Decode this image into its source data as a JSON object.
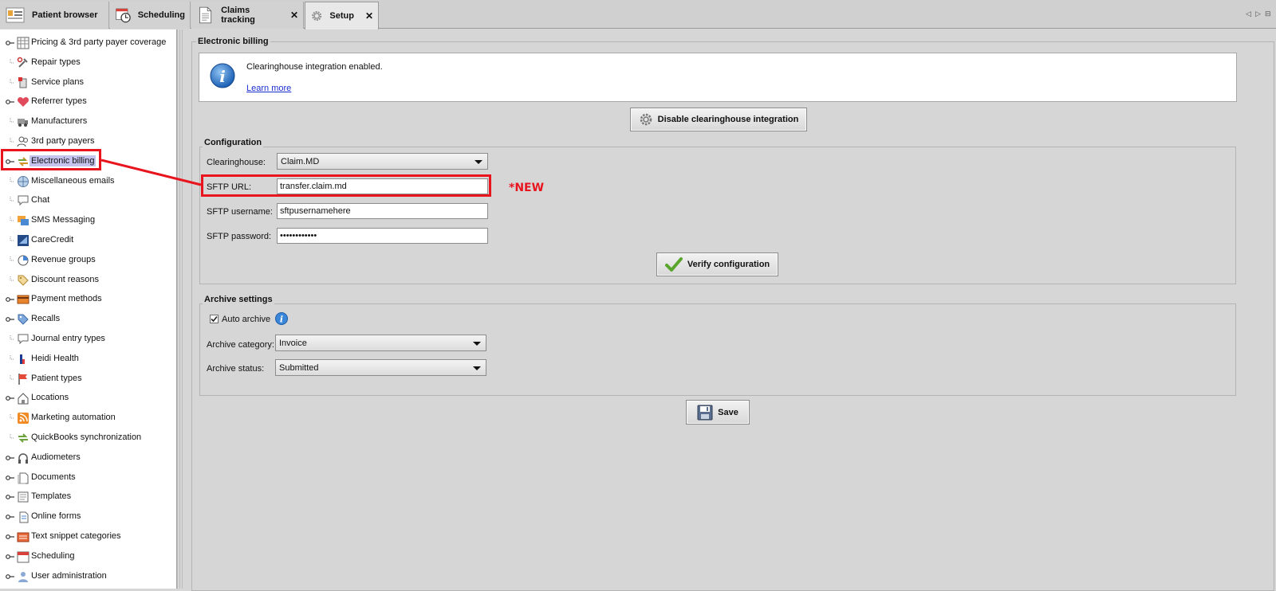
{
  "tabs": [
    {
      "label": "Patient browser",
      "icon": "patient-browser-icon",
      "active": false,
      "closable": false
    },
    {
      "label": "Scheduling",
      "icon": "calendar-clock-icon",
      "active": false,
      "closable": false
    },
    {
      "label": "Claims tracking",
      "icon": "document-icon",
      "active": false,
      "closable": true
    },
    {
      "label": "Setup",
      "icon": "gear-icon",
      "active": true,
      "closable": true
    }
  ],
  "tab_close_glyph": "✕",
  "tab_nav": {
    "left": "◁",
    "right": "▷",
    "menu": "⊟"
  },
  "tree": {
    "items": [
      {
        "label": "Pricing & 3rd party payer coverage",
        "icon": "pricing-table-icon",
        "expandable": true
      },
      {
        "label": "Repair types",
        "icon": "tools-icon",
        "expandable": false
      },
      {
        "label": "Service plans",
        "icon": "service-plan-icon",
        "expandable": false
      },
      {
        "label": "Referrer types",
        "icon": "heart-icon",
        "expandable": true
      },
      {
        "label": "Manufacturers",
        "icon": "truck-icon",
        "expandable": false
      },
      {
        "label": "3rd party payers",
        "icon": "people-icon",
        "expandable": false
      },
      {
        "label": "Electronic billing",
        "icon": "exchange-arrows-icon",
        "expandable": true,
        "selected": true
      },
      {
        "label": "Miscellaneous emails",
        "icon": "globe-icon",
        "expandable": false
      },
      {
        "label": "Chat",
        "icon": "chat-bubble-icon",
        "expandable": false
      },
      {
        "label": "SMS Messaging",
        "icon": "sms-icon",
        "expandable": false
      },
      {
        "label": "CareCredit",
        "icon": "carecredit-icon",
        "expandable": false
      },
      {
        "label": "Revenue groups",
        "icon": "pie-chart-icon",
        "expandable": false
      },
      {
        "label": "Discount reasons",
        "icon": "tag-icon",
        "expandable": false
      },
      {
        "label": "Payment methods",
        "icon": "payment-icon",
        "expandable": true
      },
      {
        "label": "Recalls",
        "icon": "recall-tag-icon",
        "expandable": true
      },
      {
        "label": "Journal entry types",
        "icon": "journal-bubble-icon",
        "expandable": false
      },
      {
        "label": "Heidi Health",
        "icon": "heidi-health-icon",
        "expandable": false
      },
      {
        "label": "Patient types",
        "icon": "flag-icon",
        "expandable": false
      },
      {
        "label": "Locations",
        "icon": "house-icon",
        "expandable": true
      },
      {
        "label": "Marketing automation",
        "icon": "rss-icon",
        "expandable": false
      },
      {
        "label": "QuickBooks synchronization",
        "icon": "sync-arrows-icon",
        "expandable": false
      },
      {
        "label": "Audiometers",
        "icon": "headphones-icon",
        "expandable": true
      },
      {
        "label": "Documents",
        "icon": "documents-icon",
        "expandable": true
      },
      {
        "label": "Templates",
        "icon": "template-icon",
        "expandable": true
      },
      {
        "label": "Online forms",
        "icon": "online-form-icon",
        "expandable": true
      },
      {
        "label": "Text snippet categories",
        "icon": "snippet-icon",
        "expandable": true
      },
      {
        "label": "Scheduling",
        "icon": "calendar-icon",
        "expandable": true
      },
      {
        "label": "User administration",
        "icon": "user-admin-icon",
        "expandable": true
      }
    ]
  },
  "main": {
    "section_title": "Electronic billing",
    "info": {
      "message": "Clearinghouse integration enabled.",
      "link": "Learn more"
    },
    "disable_button": "Disable clearinghouse integration",
    "configuration": {
      "title": "Configuration",
      "clearinghouse_label": "Clearinghouse:",
      "clearinghouse_value": "Claim.MD",
      "sftp_url_label": "SFTP URL:",
      "sftp_url_value": "transfer.claim.md",
      "sftp_username_label": "SFTP username:",
      "sftp_username_value": "sftpusernamehere",
      "sftp_password_label": "SFTP password:",
      "sftp_password_value": "••••••••••••",
      "verify_button": "Verify configuration"
    },
    "archive": {
      "title": "Archive settings",
      "auto_archive_label": "Auto archive",
      "auto_archive_checked": true,
      "category_label": "Archive category:",
      "category_value": "Invoice",
      "status_label": "Archive status:",
      "status_value": "Submitted"
    },
    "save_button": "Save"
  },
  "annotation": {
    "new_label": "*NEW",
    "color": "#e8141e"
  },
  "colors": {
    "panel_bg": "#d6d6d6",
    "tree_bg": "#ffffff",
    "selection_bg": "#c4c4ef",
    "link": "#1a2fd0"
  }
}
